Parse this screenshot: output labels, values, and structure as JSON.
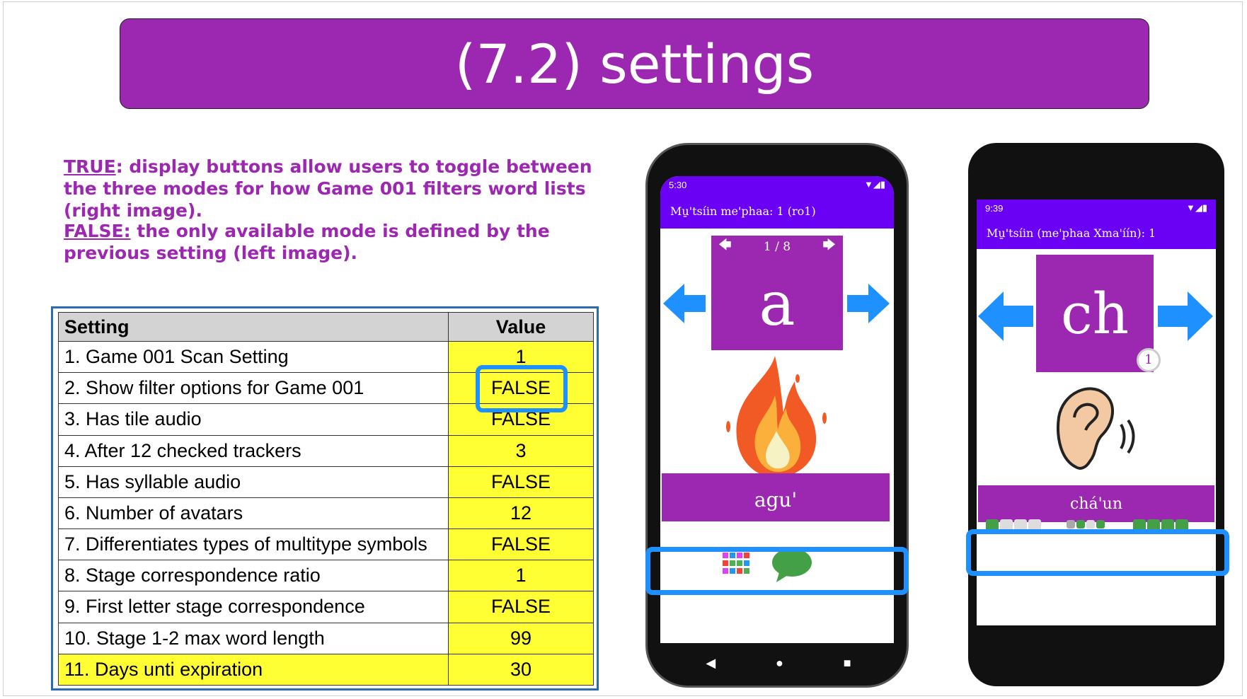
{
  "title": "(7.2) settings",
  "description": {
    "true_keyword": "TRUE",
    "true_text": ": display buttons allow users to toggle between the three modes for how Game 001 filters word lists (right image).",
    "false_keyword": "FALSE:",
    "false_text": " the only available mode is defined by the previous setting (left image)."
  },
  "table": {
    "header_setting": "Setting",
    "header_value": "Value",
    "rows": [
      {
        "setting": "1. Game 001 Scan Setting",
        "value": "1"
      },
      {
        "setting": "2. Show filter options for Game 001",
        "value": "FALSE"
      },
      {
        "setting": "3. Has tile audio",
        "value": "FALSE"
      },
      {
        "setting": "4. After 12 checked trackers",
        "value": "3"
      },
      {
        "setting": "5. Has syllable audio",
        "value": "FALSE"
      },
      {
        "setting": "6. Number of avatars",
        "value": "12"
      },
      {
        "setting": "7. Differentiates types of multitype symbols",
        "value": "FALSE"
      },
      {
        "setting": "8. Stage correspondence ratio",
        "value": "1"
      },
      {
        "setting": "9. First letter stage correspondence",
        "value": "FALSE"
      },
      {
        "setting": "10. Stage 1-2 max word length",
        "value": "99"
      },
      {
        "setting": "11. Days unti expiration",
        "value": "30"
      }
    ]
  },
  "phone_left": {
    "status_time": "5:30",
    "app_title": "Mu̱'tsíin me'phaa: 1    (ro1)",
    "page_indicator": "1 / 8",
    "tile_letter": "a",
    "word": "agu'",
    "colors": {
      "accent": "#9c27b0",
      "appbar": "#6a00f4",
      "arrow": "#1e90ff"
    }
  },
  "phone_right": {
    "status_time": "9:39",
    "app_title": "Mu̱'tsíin (me'phaa Xma'íín): 1",
    "tile_letter": "ch",
    "badge": "1",
    "word": "chá'un"
  }
}
